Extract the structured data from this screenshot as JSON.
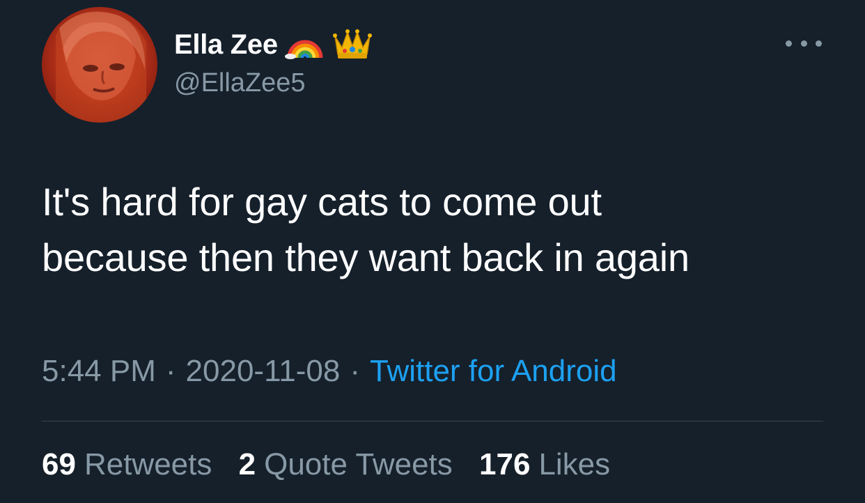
{
  "author": {
    "display_name": "Ella Zee",
    "handle": "@EllaZee5",
    "name_emojis": [
      "rainbow-icon",
      "crown-icon"
    ]
  },
  "tweet": {
    "text_line_1": "It's hard for gay cats to come out",
    "text_line_2": "because then they want back in again"
  },
  "meta": {
    "time": "5:44 PM",
    "separator": "·",
    "date": "2020-11-08",
    "source": "Twitter for Android"
  },
  "stats": {
    "retweets_count": "69",
    "retweets_label": "Retweets",
    "quotes_count": "2",
    "quotes_label": "Quote Tweets",
    "likes_count": "176",
    "likes_label": "Likes"
  },
  "colors": {
    "background": "#15202b",
    "text_primary": "#ffffff",
    "text_secondary": "#8899a6",
    "link": "#1da1f2",
    "divider": "#38444d"
  }
}
